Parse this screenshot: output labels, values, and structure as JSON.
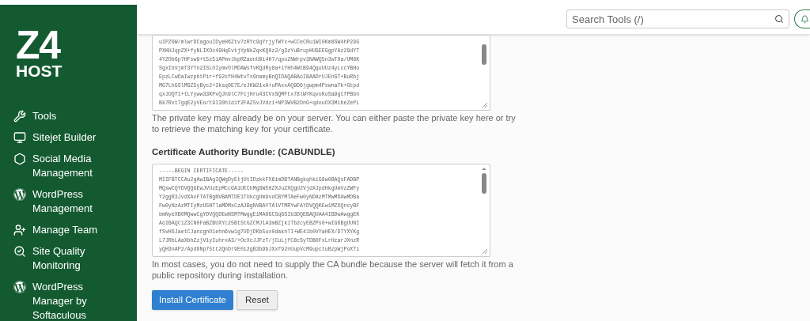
{
  "sidebar": {
    "logo": {
      "top": "Z4",
      "bottom": "HOST"
    },
    "items": [
      {
        "kind": "tools",
        "label": "Tools"
      },
      {
        "kind": "sitejet",
        "label": "Sitejet Builder"
      },
      {
        "kind": "social",
        "label": "Social Media Management"
      },
      {
        "kind": "wordpress",
        "label": "WordPress Management"
      },
      {
        "kind": "team",
        "label": "Manage Team"
      },
      {
        "kind": "quality",
        "label": "Site Quality Monitoring"
      },
      {
        "kind": "wordpress",
        "label": "WordPress Manager by Softaculous"
      }
    ]
  },
  "header": {
    "search": {
      "placeholder": "Search Tools (/)"
    }
  },
  "private_key": {
    "lines": [
      "uIPZ0W/mlwrDCagouIDyeH6Ztv7zRYc9qYrjyTWYx+wCCeCRu1WI0Km8SW4hP29G",
      "PXKHJqpZX+fyNLIXOc49HqEvtjYpNkZqxKQ0z2/g3zYuBrupHUGEEGgpYAz29dYT",
      "4YZOb6p7HFsw9+t5z5iAPmvJbpRZaonU9i4H7/qpu2NWrpv3NAWQ5n3wT0a/UM8K",
      "SgxIbVjmT3YTn2ISLOIymvOlMDAWsfvKQdRy8a+iYHh4WtB94QquUUz4yLccYBHo",
      "EpzLCwDaIwzpbtPir+f92sfH4WtvTx9namyBnQIDAQABAoIBAADrUJEnGT+BuRbj",
      "MG7LhGSlMSZ5yByc2+3ksq0E7E/eJKW21xA+uPAxxAQ9D6jgwpm4PswnaTk+Gtpd",
      "qxJUQf1+tLYyww33KPvQJh9lC7FcjHru43CVxSQMFtx78lWYKqvoKoSa9gtfPBbn",
      "Bk7Rxt7gqE2yVEo/t9I30h1d1f2FAZSvJVdzi+NP3WVB2DnG+qdouOX3MibeZePL"
    ],
    "help": "The private key may already be on your server. You can either paste the private key here or try to retrieve the matching key for your certificate."
  },
  "ca_bundle": {
    "label": "Certificate Authority Bundle: (CABUNDLE)",
    "lines": [
      "-----BEGIN CERTIFICATE-----",
      "MIIFBTCCAu2gAwIBAgIQWgDyEtjUtIDzkkFX6imDBTANBgkqhkiG9w0BAQsFADBP",
      "MQswCQYDVQQGEwJVUzEpMCcGA1UEChMgSW50ZXJuZXQgU2VjdXJpdHkgUmVzZWFy",
      "Y2ggR3JvdXAxFTATBgNVBAMTDE1TUkcgUm9vdCBYMTAeFw0yNDAzMTMwMDAwMDBa",
      "Fw0yNzAzMTIyMzU5NTlaMDMxCzAJBgNVBAYTAlVTMRYwFAYDVQQKEw1MZXQncyBF",
      "bmNyeXB0MQwwCgYDVQQDEwNSMTMwggEiMA0GCSqGSIb3DQEBAQUAA4IBDwAwggEK",
      "AoIBAQC1Z3CN0FaBZBUXYc25BtStGZCMJ1A3mBZjk1Tb2cyEBZPs0+wIG6BgUUNI",
      "fSvHSJaetCJancgnO1ehn6vw1g7UDjDKb5ux0daknTI+WE41b0VYaHEX/D7YXYKg",
      "L7JRbLAaXbhZzjV1yIuhrxA3/+OcXcJJFzT/jCuLjfC8cSyTDB0FxLrHzarJXnzR",
      "yQH3nAP2/Apd9Np75tt2QnDr9E0i2gB3b9bJXxf92nUupVcM9upctuBzpWjPoXTi"
    ],
    "help": "In most cases, you do not need to supply the CA bundle because the server will fetch it from a public repository during installation."
  },
  "buttons": [
    {
      "kind": "primary",
      "label": "Install Certificate"
    },
    {
      "kind": "secondary",
      "label": "Reset"
    }
  ]
}
